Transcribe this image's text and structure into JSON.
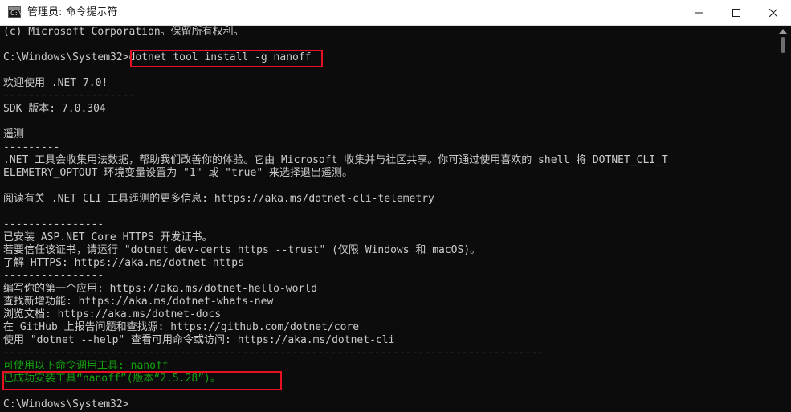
{
  "window": {
    "title": "管理员: 命令提示符",
    "icon_glyph": "C:\\",
    "icons": {
      "app": "cmd-icon",
      "minimize": "minimize-icon",
      "maximize": "maximize-icon",
      "close": "close-icon"
    }
  },
  "console": {
    "lines": [
      "(c) Microsoft Corporation。保留所有权利。",
      "",
      "C:\\Windows\\System32>dotnet tool install -g nanoff",
      "",
      "欢迎使用 .NET 7.0!",
      "---------------------",
      "SDK 版本: 7.0.304",
      "",
      "遥测",
      "---------",
      ".NET 工具会收集用法数据，帮助我们改善你的体验。它由 Microsoft 收集并与社区共享。你可通过使用喜欢的 shell 将 DOTNET_CLI_T",
      "ELEMETRY_OPTOUT 环境变量设置为 \"1\" 或 \"true\" 来选择退出遥测。",
      "",
      "阅读有关 .NET CLI 工具遥测的更多信息: https://aka.ms/dotnet-cli-telemetry",
      "",
      "----------------",
      "已安装 ASP.NET Core HTTPS 开发证书。",
      "若要信任该证书，请运行 \"dotnet dev-certs https --trust\" (仅限 Windows 和 macOS)。",
      "了解 HTTPS: https://aka.ms/dotnet-https",
      "----------------",
      "编写你的第一个应用: https://aka.ms/dotnet-hello-world",
      "查找新增功能: https://aka.ms/dotnet-whats-new",
      "浏览文档: https://aka.ms/dotnet-docs",
      "在 GitHub 上报告问题和查找源: https://github.com/dotnet/core",
      "使用 \"dotnet --help\" 查看可用命令或访问: https://aka.ms/dotnet-cli",
      "--------------------------------------------------------------------------------------",
      "可使用以下命令调用工具: nanoff",
      "已成功安装工具“nanoff”(版本“2.5.28”)。",
      "",
      "C:\\Windows\\System32>"
    ],
    "prompt": "C:\\Windows\\System32>",
    "command": "dotnet tool install -g nanoff"
  },
  "colors": {
    "text": "#cccccc",
    "success": "#13a10e",
    "highlight": "#e81123",
    "background": "#0c0c0c"
  }
}
